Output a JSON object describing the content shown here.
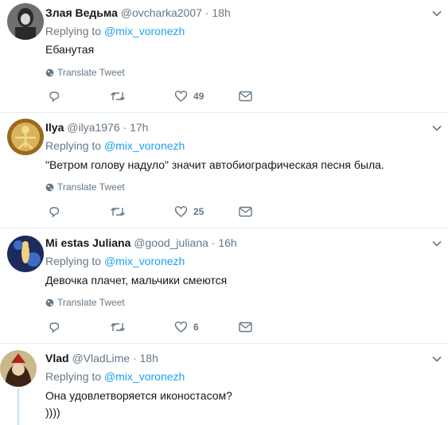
{
  "tweets": [
    {
      "name": "Злая Ведьма",
      "handle": "@ovcharka2007",
      "dot": "·",
      "time": "18h",
      "replying_prefix": "Replying to",
      "replying_to": "@mix_voronezh",
      "text_lines": [
        "Ебанутая"
      ],
      "translate": "Translate Tweet",
      "likes": "49",
      "avatar_colors": [
        "#6f7070",
        "#2a2a2a",
        "#d9d9d9"
      ]
    },
    {
      "name": "Ilya",
      "handle": "@ilya1976",
      "dot": "·",
      "time": "17h",
      "replying_prefix": "Replying to",
      "replying_to": "@mix_voronezh",
      "text_lines": [
        "\"Ветром голову надуло\" значит автобиографическая песня была."
      ],
      "translate": "Translate Tweet",
      "likes": "25",
      "avatar_colors": [
        "#9a6a1c",
        "#d8b35c",
        "#f0dc8c"
      ]
    },
    {
      "name": "Mi estas Juliana",
      "handle": "@good_juliana",
      "dot": "·",
      "time": "16h",
      "replying_prefix": "Replying to",
      "replying_to": "@mix_voronezh",
      "text_lines": [
        "Девочка плачет, мальчики смеются"
      ],
      "translate": "Translate Tweet",
      "likes": "6",
      "avatar_colors": [
        "#1c2a5c",
        "#3d6cc4",
        "#f3d07a"
      ]
    },
    {
      "name": "Vlad",
      "handle": "@VladLime",
      "dot": "·",
      "time": "18h",
      "replying_prefix": "Replying to",
      "replying_to": "@mix_voronezh",
      "text_lines": [
        "Она удовлетворяется иконостасом?",
        "))))"
      ],
      "avatar_colors": [
        "#c9b98a",
        "#3b2414",
        "#b02020"
      ]
    }
  ],
  "colors": {
    "accent": "#1da1f2",
    "muted": "#657786",
    "divider": "#e6ecf0",
    "thread_line": "#c4e4fb"
  },
  "icons": {
    "reply": "reply-icon",
    "retweet": "retweet-icon",
    "like": "heart-icon",
    "dm": "envelope-icon",
    "translate": "globe-icon",
    "caret": "chevron-down-icon"
  }
}
